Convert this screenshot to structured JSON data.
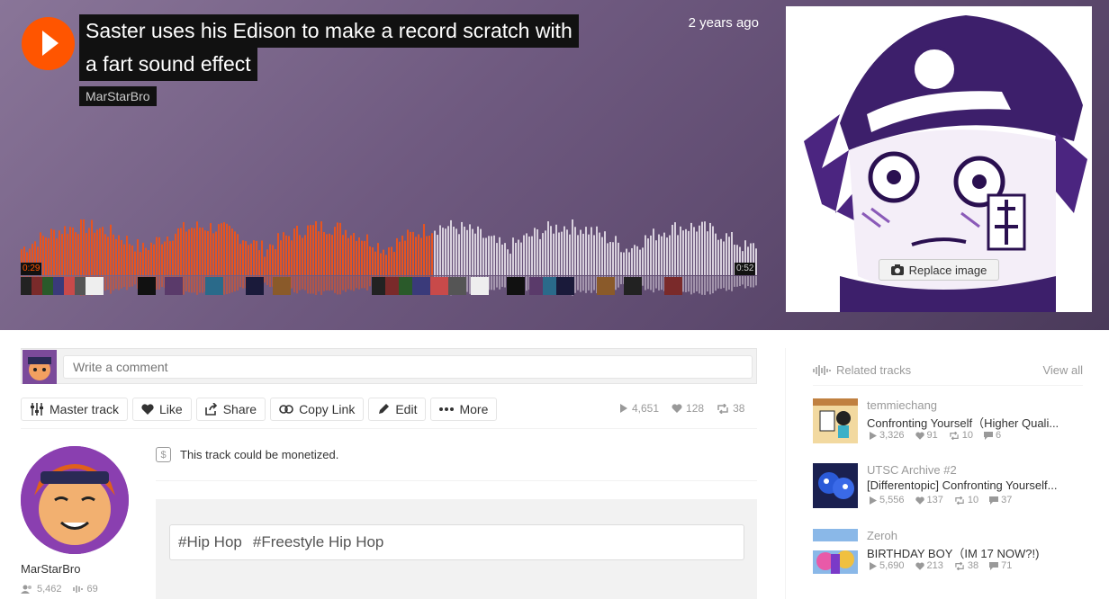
{
  "hero": {
    "title_line1": "Saster uses his Edison to make a record scratch with",
    "title_line2": "a fart sound effect",
    "artist": "MarStarBro",
    "posted": "2 years ago",
    "time_current": "0:29",
    "time_total": "0:52",
    "progress": 0.56,
    "replace_image": "Replace image"
  },
  "comment": {
    "placeholder": "Write a comment"
  },
  "actions": {
    "master": "Master track",
    "like": "Like",
    "share": "Share",
    "copy": "Copy Link",
    "edit": "Edit",
    "more": "More"
  },
  "stats": {
    "plays": "4,651",
    "likes": "128",
    "reposts": "38"
  },
  "uploader": {
    "name": "MarStarBro",
    "followers": "5,462",
    "tracks": "69"
  },
  "monetize": "This track could be monetized.",
  "tags": [
    "#Hip Hop",
    "#Freestyle Hip Hop"
  ],
  "related": {
    "header": "Related tracks",
    "view_all": "View all",
    "items": [
      {
        "user": "temmiechang",
        "title": "Confronting Yourself（Higher Quali...",
        "plays": "3,326",
        "likes": "91",
        "reposts": "10",
        "comments": "6"
      },
      {
        "user": "UTSC Archive #2",
        "title": "[Differentopic] Confronting Yourself...",
        "plays": "5,556",
        "likes": "137",
        "reposts": "10",
        "comments": "37"
      },
      {
        "user": "Zeroh",
        "title": "BIRTHDAY BOY（IM 17 NOW?!)",
        "plays": "5,690",
        "likes": "213",
        "reposts": "38",
        "comments": "71"
      }
    ]
  },
  "colors": {
    "accent": "#ff5500",
    "played_wave": "#e8541f",
    "unplayed_wave": "#d8d0dd"
  }
}
